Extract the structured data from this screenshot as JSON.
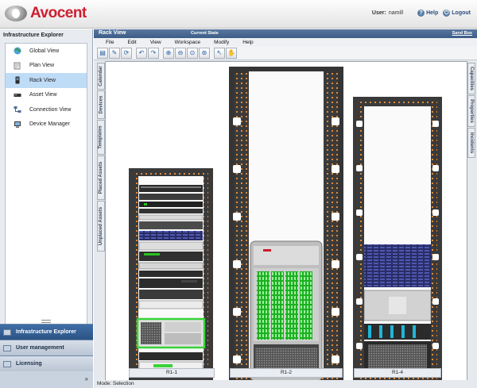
{
  "header": {
    "brand": "Avocent",
    "user_label": "User:",
    "user_name": "namill",
    "help": "Help",
    "logout": "Logout"
  },
  "left_panel": {
    "title": "Infrastructure Explorer",
    "items": [
      {
        "label": "Global View",
        "icon": "globe-icon"
      },
      {
        "label": "Plan View",
        "icon": "plan-icon"
      },
      {
        "label": "Rack View",
        "icon": "rack-icon",
        "active": true
      },
      {
        "label": "Asset View",
        "icon": "asset-icon"
      },
      {
        "label": "Connection View",
        "icon": "connection-icon"
      },
      {
        "label": "Device Manager",
        "icon": "device-manager-icon"
      }
    ],
    "accordion": {
      "infra": "Infrastructure Explorer",
      "users": "User management",
      "licensing": "Licensing",
      "more": "»"
    }
  },
  "window": {
    "title": "Rack View",
    "state": "Current State",
    "sandbox": "Sand Box",
    "menu": [
      "File",
      "Edit",
      "View",
      "Workspace",
      "Modify",
      "Help"
    ],
    "left_tabs": [
      "Calendar",
      "Devices",
      "Templates",
      "Placed Assets",
      "Unplaced Assets"
    ],
    "right_tabs": [
      "Capacities",
      "Properties",
      "Incidents"
    ],
    "status": "Mode: Selection"
  },
  "racks": [
    {
      "label": "R1-1"
    },
    {
      "label": "R1-2"
    },
    {
      "label": "R1-4"
    }
  ],
  "colors": {
    "header_brand": "#cc1f2f",
    "selection_green": "#38d43a",
    "rack_dark": "#3a3a3a",
    "titlebar": "#4a6b95"
  }
}
